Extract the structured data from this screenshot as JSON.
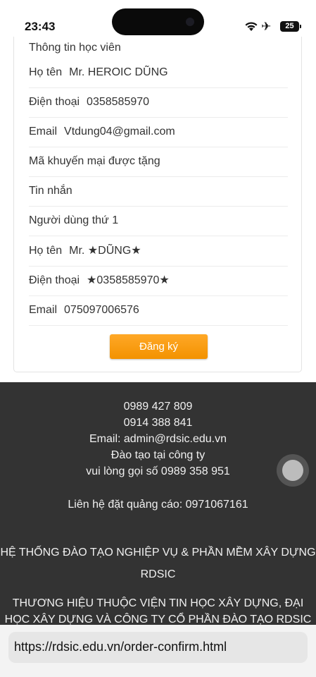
{
  "status": {
    "time": "23:43",
    "battery": "25"
  },
  "form": {
    "section_title": "Thông tin học viên",
    "rows": [
      {
        "label": "Họ tên",
        "value": "Mr. HEROIC DŨNG"
      },
      {
        "label": "Điện thoại",
        "value": "0358585970"
      },
      {
        "label": "Email",
        "value": "Vtdung04@gmail.com"
      },
      {
        "label": "Mã khuyến mại được tặng",
        "value": ""
      },
      {
        "label": "Tin nhắn",
        "value": ""
      },
      {
        "label": "Người dùng thứ 1",
        "value": ""
      },
      {
        "label": "Họ tên",
        "value": "Mr. ★DŨNG★"
      },
      {
        "label": "Điện thoại",
        "value": "★0358585970★"
      },
      {
        "label": "Email",
        "value": "075097006576"
      }
    ],
    "submit_label": "Đăng ký"
  },
  "footer": {
    "phone1": "0989 427 809",
    "phone2": "0914 388 841",
    "email": "Email: admin@rdsic.edu.vn",
    "training": "Đào tạo tại công ty",
    "call": "vui lòng gọi số 0989 358 951",
    "ads": "Liên hệ đặt quảng cáo: 0971067161",
    "system_line1": "HỆ THỐNG ĐÀO TẠO NGHIỆP VỤ & PHẦN MỀM XÂY DỰNG",
    "system_line2": "RDSIC",
    "brand_line1": "THƯƠNG HIỆU THUỘC VIỆN TIN HỌC XÂY DỰNG, ĐẠI",
    "brand_line2": "HỌC XÂY DỰNG VÀ CÔNG TY CỔ PHẦN ĐÀO TẠO RDSIC"
  },
  "browser": {
    "url": "https://rdsic.edu.vn/order-confirm.html"
  }
}
